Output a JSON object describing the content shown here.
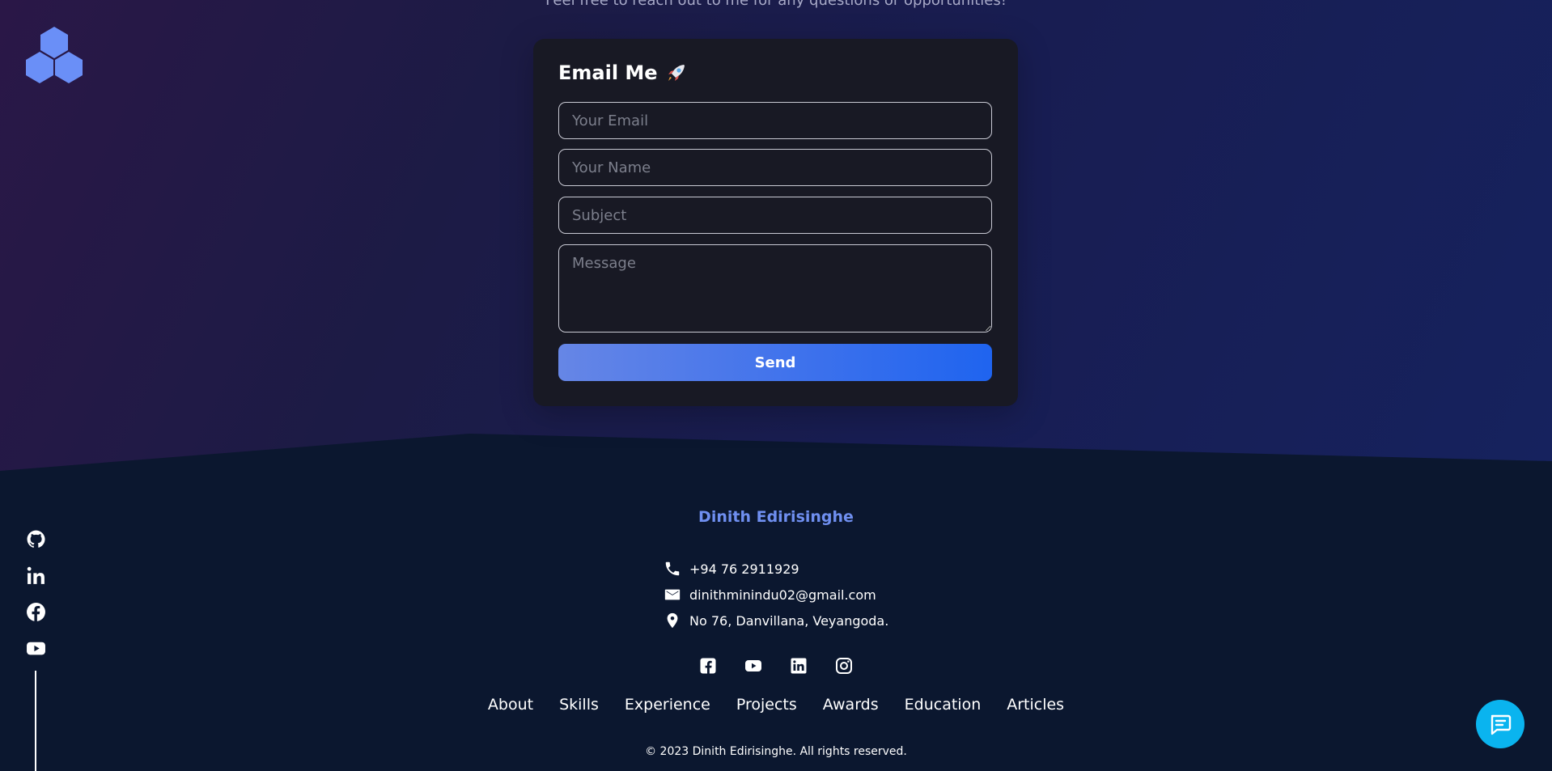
{
  "intro": {
    "text": "Feel free to reach out to me for any questions or opportunities!"
  },
  "logo": {
    "icon": "hexagon-cluster-icon",
    "color": "#6a8ff7"
  },
  "contact_form": {
    "title": "Email Me",
    "title_icon": "rocket-icon",
    "email_placeholder": "Your Email",
    "name_placeholder": "Your Name",
    "subject_placeholder": "Subject",
    "message_placeholder": "Message",
    "send_label": "Send"
  },
  "side_social": [
    "github-icon",
    "linkedin-icon",
    "facebook-icon",
    "youtube-icon"
  ],
  "footer": {
    "name": "Dinith Edirisinghe",
    "contact": {
      "phone": "+94 76 2911929",
      "email": "dinithminindu02@gmail.com",
      "address": "No 76, Danvillana, Veyangoda."
    },
    "social": [
      "facebook-icon",
      "youtube-icon",
      "linkedin-icon",
      "instagram-icon"
    ],
    "nav": [
      "About",
      "Skills",
      "Experience",
      "Projects",
      "Awards",
      "Education",
      "Articles"
    ],
    "copyright": "© 2023 Dinith Edirisinghe. All rights reserved."
  },
  "chat": {
    "icon": "chat-bubble-icon",
    "color": "#0ab4ef"
  },
  "colors": {
    "accent": "#6f8ff0",
    "card_bg": "#181924",
    "footer_bg": "#0b172f",
    "button_gradient_start": "#6686e6",
    "button_gradient_end": "#1f64ef"
  }
}
